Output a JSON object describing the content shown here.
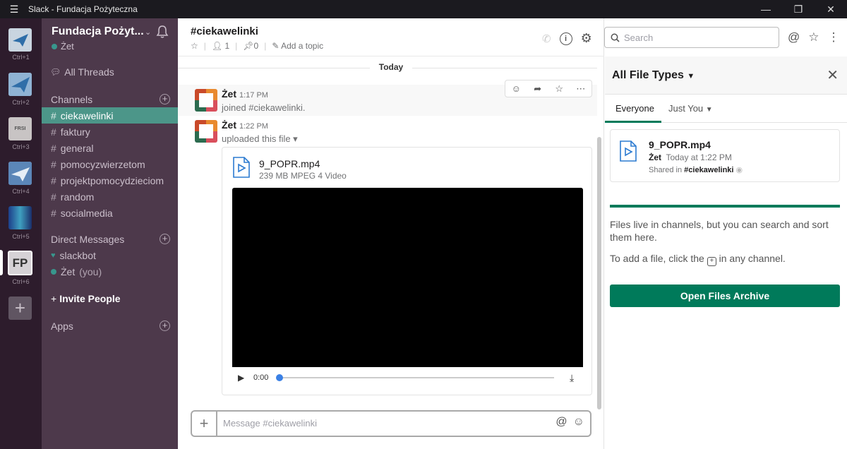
{
  "window": {
    "title": "Slack - Fundacja Pożyteczna",
    "menu_glyph": "☰",
    "controls": [
      "—",
      "❐",
      "✕"
    ]
  },
  "teams": [
    {
      "shortcut": "Ctrl+1"
    },
    {
      "shortcut": "Ctrl+2"
    },
    {
      "shortcut": "Ctrl+3",
      "text": "FRSI"
    },
    {
      "shortcut": "Ctrl+4"
    },
    {
      "shortcut": "Ctrl+5"
    },
    {
      "shortcut": "Ctrl+6",
      "initials": "FP"
    }
  ],
  "sidebar": {
    "workspace": "Fundacja Pożyt...",
    "user": "Żet",
    "all_threads": "All Threads",
    "channels_header": "Channels",
    "channels": [
      "ciekawelinki",
      "faktury",
      "general",
      "pomocyzwierzetom",
      "projektpomocydzieciom",
      "random",
      "socialmedia"
    ],
    "dm_header": "Direct Messages",
    "dms": [
      {
        "name": "slackbot",
        "suffix": ""
      },
      {
        "name": "Żet",
        "suffix": "(you)"
      }
    ],
    "invite": "Invite People",
    "apps": "Apps"
  },
  "channel": {
    "name": "#ciekawelinki",
    "members": "1",
    "pins": "0",
    "add_topic": "Add a topic"
  },
  "messages": {
    "divider": "Today",
    "m1": {
      "author": "Żet",
      "time": "1:17 PM",
      "text": "joined #ciekawelinki."
    },
    "m2": {
      "author": "Żet",
      "time": "1:22 PM",
      "text": "uploaded this file ▾"
    }
  },
  "file": {
    "name": "9_POPR.mp4",
    "meta": "239 MB MPEG 4 Video",
    "time": "0:00",
    "progress": 0
  },
  "composer": {
    "placeholder": "Message #ciekawelinki"
  },
  "search": {
    "placeholder": "Search"
  },
  "files_panel": {
    "title": "All File Types",
    "tab_everyone": "Everyone",
    "tab_just_you": "Just You",
    "file_name": "9_POPR.mp4",
    "file_by": "Żet",
    "file_when": "Today at 1:22 PM",
    "shared_prefix": "Shared in",
    "shared_channel": "#ciekawelinki",
    "info1": "Files live in channels, but you can search and sort them here.",
    "info2_before": "To add a file, click the",
    "info2_after": "in any channel.",
    "button": "Open Files Archive"
  },
  "colors": {
    "sidebar": "#4d394b",
    "active_channel": "#4c9689",
    "team_bar": "#2d1c2c",
    "accent_green": "#007a5a",
    "file_icon": "#2c7bd1"
  }
}
